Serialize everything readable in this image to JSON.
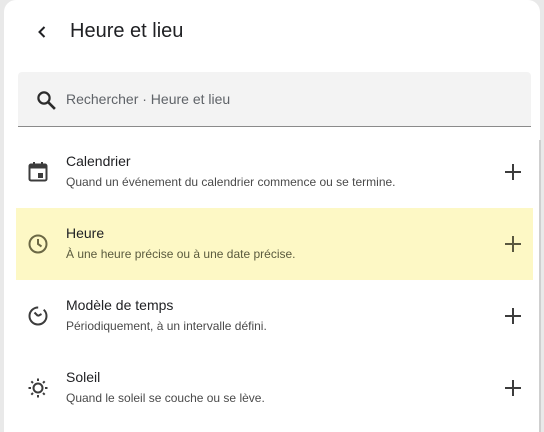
{
  "header": {
    "title": "Heure et lieu"
  },
  "search": {
    "placeholder": "Rechercher · Heure et lieu",
    "value": ""
  },
  "items": [
    {
      "title": "Calendrier",
      "subtitle": "Quand un événement du calendrier commence ou se termine.",
      "icon": "calendar-icon"
    },
    {
      "title": "Heure",
      "subtitle": "À une heure précise ou à une date précise.",
      "icon": "clock-icon"
    },
    {
      "title": "Modèle de temps",
      "subtitle": "Périodiquement, à un intervalle défini.",
      "icon": "timer-pattern-icon"
    },
    {
      "title": "Soleil",
      "subtitle": "Quand le soleil se couche ou se lève.",
      "icon": "sun-icon"
    }
  ],
  "colors": {
    "highlight": "#fdf8c5",
    "text": "#202124",
    "icon": "#3c3c3c",
    "active_icon": "#6b6845"
  }
}
